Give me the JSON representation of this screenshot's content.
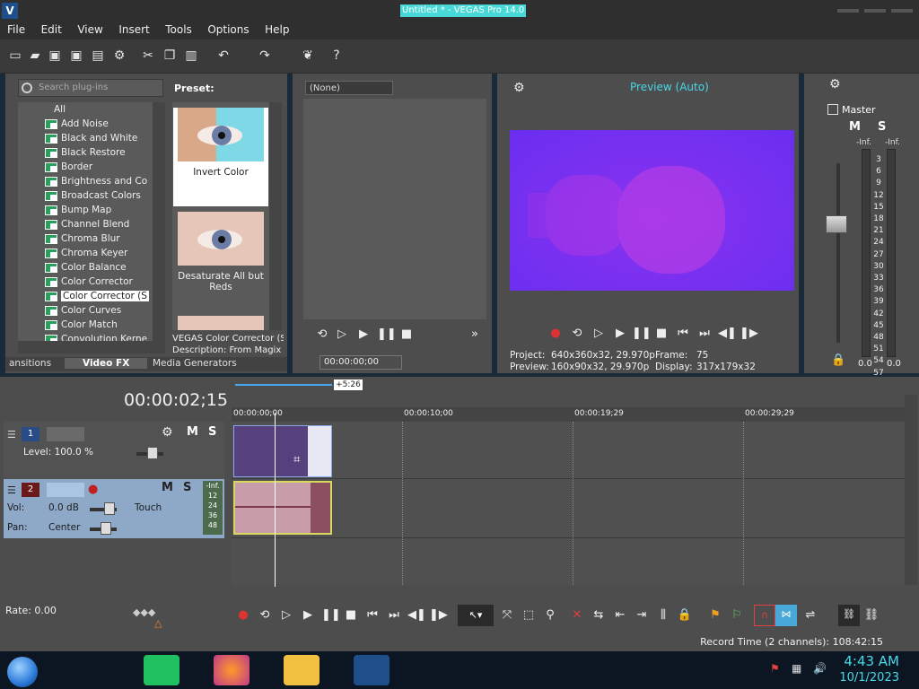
{
  "window": {
    "title": "Untitled * - VEGAS Pro 14.0"
  },
  "menu": [
    "File",
    "Edit",
    "View",
    "Insert",
    "Tools",
    "Options",
    "Help"
  ],
  "plugins": {
    "search_placeholder": "Search plug-ins",
    "preset_label": "Preset:",
    "root": "All",
    "items": [
      "Add Noise",
      "Black and White",
      "Black Restore",
      "Border",
      "Brightness and Co",
      "Broadcast Colors",
      "Bump Map",
      "Channel Blend",
      "Chroma Blur",
      "Chroma Keyer",
      "Color Balance",
      "Color Corrector",
      "Color Corrector (S",
      "Color Curves",
      "Color Match",
      "Convolution Kerne"
    ],
    "selected_index": 12,
    "presets": [
      "Invert Color",
      "Desaturate All but Reds"
    ],
    "description_line1": "VEGAS Color Corrector (S",
    "description_line2": "Description: From Magix "
  },
  "dock_tabs": [
    "ansitions",
    "Video FX",
    "Media Generators"
  ],
  "dock_active": "Video FX",
  "trimmer": {
    "selector": "(None)",
    "time": "00:00:00;00"
  },
  "preview": {
    "mode": "Preview (Auto)",
    "project_label": "Project:",
    "project_value": "640x360x32, 29.970p",
    "frame_label": "Frame:",
    "frame_value": "75",
    "preview_label": "Preview:",
    "preview_value": "160x90x32, 29.970p",
    "display_label": "Display:",
    "display_value": "317x179x32"
  },
  "master": {
    "label": "Master",
    "m": "M",
    "s": "S",
    "inf_left": "-Inf.",
    "inf_right": "-Inf.",
    "val_left": "0.0",
    "val_right": "0.0",
    "scale": [
      "3",
      "6",
      "9",
      "12",
      "15",
      "18",
      "21",
      "24",
      "27",
      "30",
      "33",
      "36",
      "39",
      "42",
      "45",
      "48",
      "51",
      "54",
      "57"
    ]
  },
  "timeline": {
    "cursor_time": "00:00:02;15",
    "marker_delta": "+5:26",
    "ruler": [
      "00:00:00;00",
      "00:00:10;00",
      "00:00:19;29",
      "00:00:29;29"
    ]
  },
  "video_track": {
    "number": "1",
    "level_label": "Level: 100.0 %",
    "m": "M",
    "s": "S"
  },
  "audio_track": {
    "number": "2",
    "m": "M",
    "s": "S",
    "vol_label": "Vol:",
    "vol_value": "0.0 dB",
    "pan_label": "Pan:",
    "pan_value": "Center",
    "automation": "Touch",
    "meter_top": "-Inf.",
    "meter_scale": [
      "12",
      "24",
      "36",
      "48"
    ]
  },
  "transport": {
    "rate": "Rate: 0.00"
  },
  "status": {
    "record_time": "Record Time (2 channels): 108:42:15"
  },
  "taskbar": {
    "time": "4:43 AM",
    "date": "10/1/2023"
  },
  "colors": {
    "accent": "#48d8e8",
    "video_bg": "#6a2ef0",
    "panel": "#4d4d4d"
  }
}
